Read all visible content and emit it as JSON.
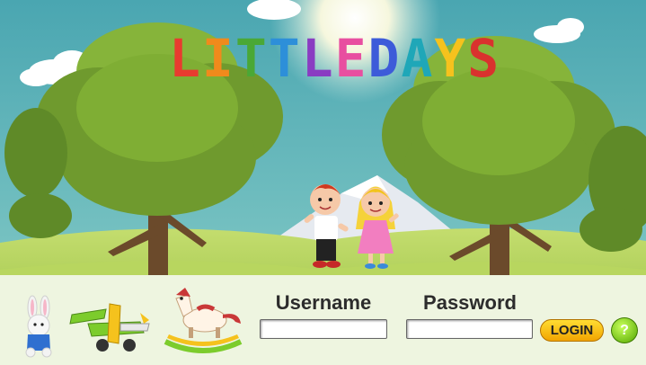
{
  "app": {
    "title": "LITTLE DAYS",
    "title_colors": [
      "#e83b2f",
      "#f08a1c",
      "#f6c21d",
      "#5cb531",
      "#2d8fd9",
      "#8a3cc2",
      "#e84fa0",
      "#3d5bd9",
      "#1fa7b8",
      "#d9322e",
      "#2da845"
    ]
  },
  "login": {
    "username_label": "Username",
    "password_label": "Password",
    "username_value": "",
    "password_value": "",
    "login_label": "LOGIN",
    "help_label": "?"
  },
  "colors": {
    "sky": "#56aeb4",
    "grass": "#a9cc55",
    "tree": "#6f9a2e",
    "bar": "#eef5e0",
    "login_button": "#f5b000",
    "help_button": "#7ccc1c"
  }
}
